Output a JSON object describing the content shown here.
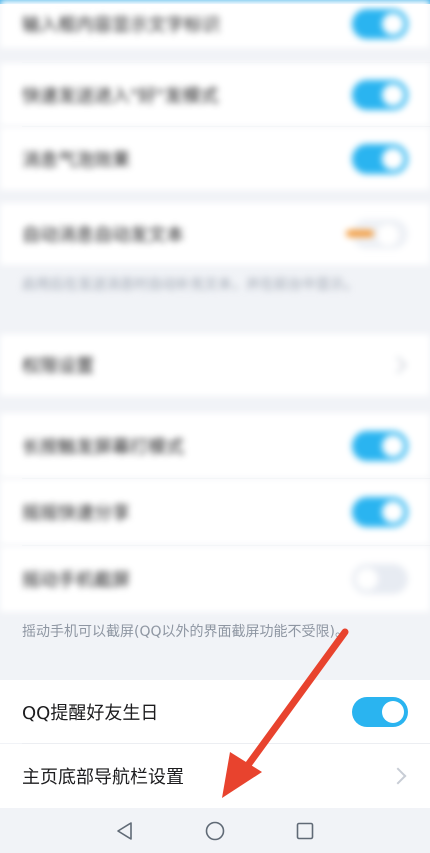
{
  "settings": {
    "row1_label": "输入框内容显示文字标识",
    "row2_label": "快速发送进入\"好\"发模式",
    "row3_label": "消息气泡效果",
    "row4_label": "自动消息自动发文本",
    "note1": "启用后在发送消息时自动补充文本，并在前台中显示。",
    "row5_label": "权限设置",
    "row6_label": "长按触发屏幕打模式",
    "row7_label": "摇摇快速分享",
    "row8_label": "摇动手机截屏",
    "note2": "摇动手机可以截屏(QQ以外的界面截屏功能不受限)。",
    "row9_label": "QQ提醒好友生日",
    "row10_label": "主页底部导航栏设置"
  },
  "toggles": {
    "row1": "on",
    "row2": "on",
    "row3": "on",
    "row4": "orange",
    "row6": "on",
    "row7": "on",
    "row8": "off",
    "row9": "on"
  },
  "icons": {
    "back": "triangle-back-icon",
    "home": "circle-home-icon",
    "recents": "square-recents-icon",
    "annotation": "red-arrow-annotation"
  },
  "colors": {
    "toggle_on": "#2ab4f0",
    "arrow": "#e8432e",
    "accent_orange": "#f39a3a"
  }
}
